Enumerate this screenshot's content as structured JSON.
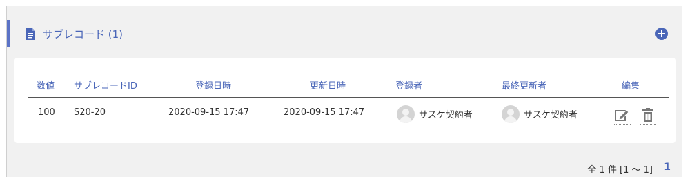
{
  "section": {
    "title": "サブレコード (1)"
  },
  "table": {
    "headers": [
      "数値",
      "サブレコードID",
      "登録日時",
      "更新日時",
      "登録者",
      "最終更新者",
      "編集"
    ],
    "rows": [
      {
        "number": "100",
        "subrecord_id": "S20-20",
        "registered_at": "2020-09-15 17:47",
        "updated_at": "2020-09-15 17:47",
        "registered_by": "サスケ契約者",
        "last_updated_by": "サスケ契約者"
      }
    ]
  },
  "pagination": {
    "summary": "全 1 件 [1 ～ 1]",
    "current_page": "1"
  },
  "colors": {
    "accent": "#4a66b8",
    "panel_bg": "#f1f1f1"
  },
  "icons": {
    "section": "document-icon",
    "add": "plus-circle-icon",
    "edit": "edit-icon",
    "delete": "trash-icon",
    "avatar": "user-avatar-icon"
  }
}
